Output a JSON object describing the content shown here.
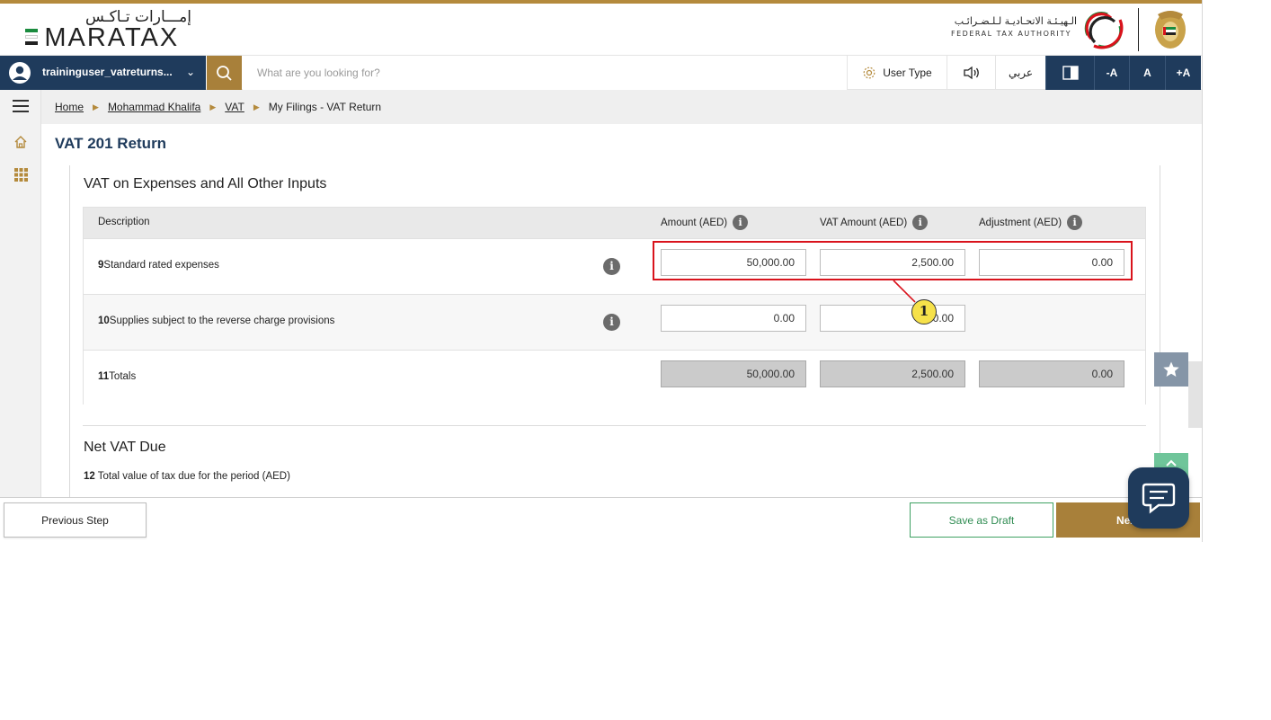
{
  "header": {
    "logo_ar": "إمـــارات تـاكـس",
    "logo_en": "MARATAX",
    "logo_e_mark": "E",
    "fta_name_ar": "الـهيـئـة الاتحـاديـة لـلـضـرائـب",
    "fta_name_en": "FEDERAL TAX AUTHORITY"
  },
  "topbar": {
    "username": "traininguser_vatreturns...",
    "search_placeholder": "What are you looking for?",
    "user_type_label": "User Type",
    "language_label": "عربي",
    "font_decrease_label": "-A",
    "font_normal_label": "A",
    "font_increase_label": "+A"
  },
  "breadcrumb": {
    "items": [
      "Home",
      "Mohammad Khalifa",
      "VAT"
    ],
    "current": "My Filings - VAT Return"
  },
  "page": {
    "title": "VAT 201 Return",
    "section_title": "VAT on Expenses and All Other Inputs"
  },
  "table": {
    "headers": {
      "description": "Description",
      "amount": "Amount (AED)",
      "vat_amount": "VAT Amount (AED)",
      "adjustment": "Adjustment (AED)"
    },
    "rows": [
      {
        "num": "9",
        "label": "Standard rated expenses",
        "amount": "50,000.00",
        "vat_amount": "2,500.00",
        "adjustment": "0.00"
      },
      {
        "num": "10",
        "label": "Supplies subject to the reverse charge provisions",
        "amount": "0.00",
        "vat_amount": "0.00"
      },
      {
        "num": "11",
        "label": "Totals",
        "amount": "50,000.00",
        "vat_amount": "2,500.00",
        "adjustment": "0.00"
      }
    ]
  },
  "callout": {
    "label": "1"
  },
  "net_vat": {
    "title": "Net VAT Due",
    "line_num": "12",
    "line_label": " Total value of tax due for the period (AED)"
  },
  "footer": {
    "previous_label": "Previous Step",
    "save_draft_label": "Save as Draft",
    "next_label": "Next"
  },
  "colors": {
    "navy": "#1f3b5c",
    "gold": "#a8803a",
    "highlight_red": "#d9131c",
    "callout_yellow": "#f6e14a",
    "green": "#3fa163"
  }
}
